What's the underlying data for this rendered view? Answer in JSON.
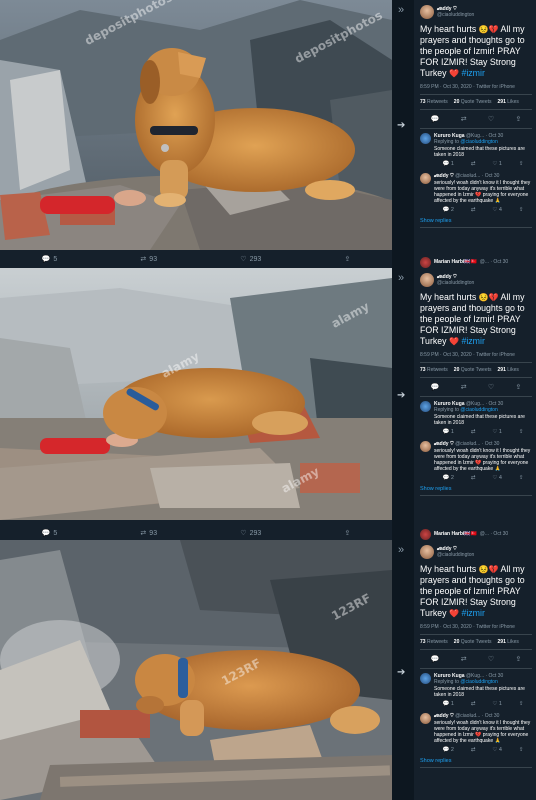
{
  "tweet": {
    "name": "𝓭addy ♡",
    "handle": "@ciaoluddington",
    "text_a": "My heart hurts ",
    "emoji_a": "😣💔",
    "text_b": " All my prayers and thoughts go to the people of Izmir! PRAY FOR IZMIR! Stay Strong Turkey ",
    "heart": "❤️",
    "hashtag": "#izmir",
    "meta": "8:59 PM · Oct 30, 2020 · Twitter for iPhone",
    "retweets": "73",
    "retweets_label": "Retweets",
    "quotes": "20",
    "quotes_label": "Quote Tweets",
    "likes": "291",
    "likes_label": "Likes"
  },
  "photo_actions": {
    "replies": "5",
    "retweets": "93",
    "likes": "293"
  },
  "replies": [
    {
      "name": "Kururo Kuga",
      "handle": "@Kug... · Oct 30",
      "replying_prefix": "Replying to",
      "replying_to": "@ciaoluddington",
      "text": "Someone claimed that these pictures are taken in 2018",
      "counts": [
        "1",
        "",
        "1"
      ]
    },
    {
      "name": "𝓭addy ♡",
      "handle": "@ciaolud... · Oct 30",
      "text": "seriously! woah didn't know it I thought they were from today anyway it's terrible what happened in Izmir 💔 praying for everyone affected by the earthquake 🙏",
      "counts": [
        "2",
        "",
        "4"
      ]
    }
  ],
  "show_replies": "Show replies",
  "bottom_reply": {
    "name": "Marian Harbi🇬🇧🇹🇷",
    "handle": "@... · Oct 30",
    "replying": "Replying to @ciaoluddington"
  },
  "watermarks": [
    "depositphotos",
    "alamy",
    "123RF"
  ]
}
